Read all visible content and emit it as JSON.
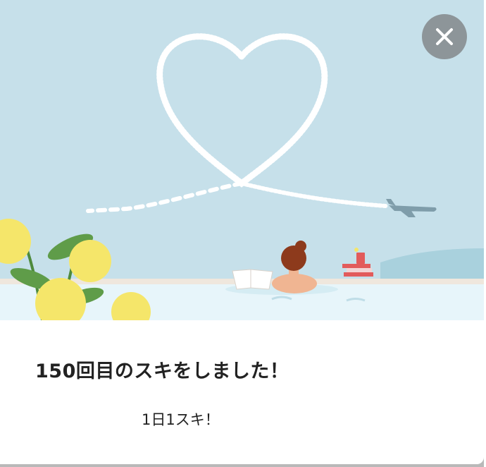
{
  "modal": {
    "title": "150回目のスキをしました！",
    "subtitle": "1日1スキ！",
    "close_icon": "close-icon"
  },
  "illustration": {
    "sky_color": "#c6e0ea",
    "water_color": "#e7f5fa",
    "flower_color": "#f5e66a"
  }
}
